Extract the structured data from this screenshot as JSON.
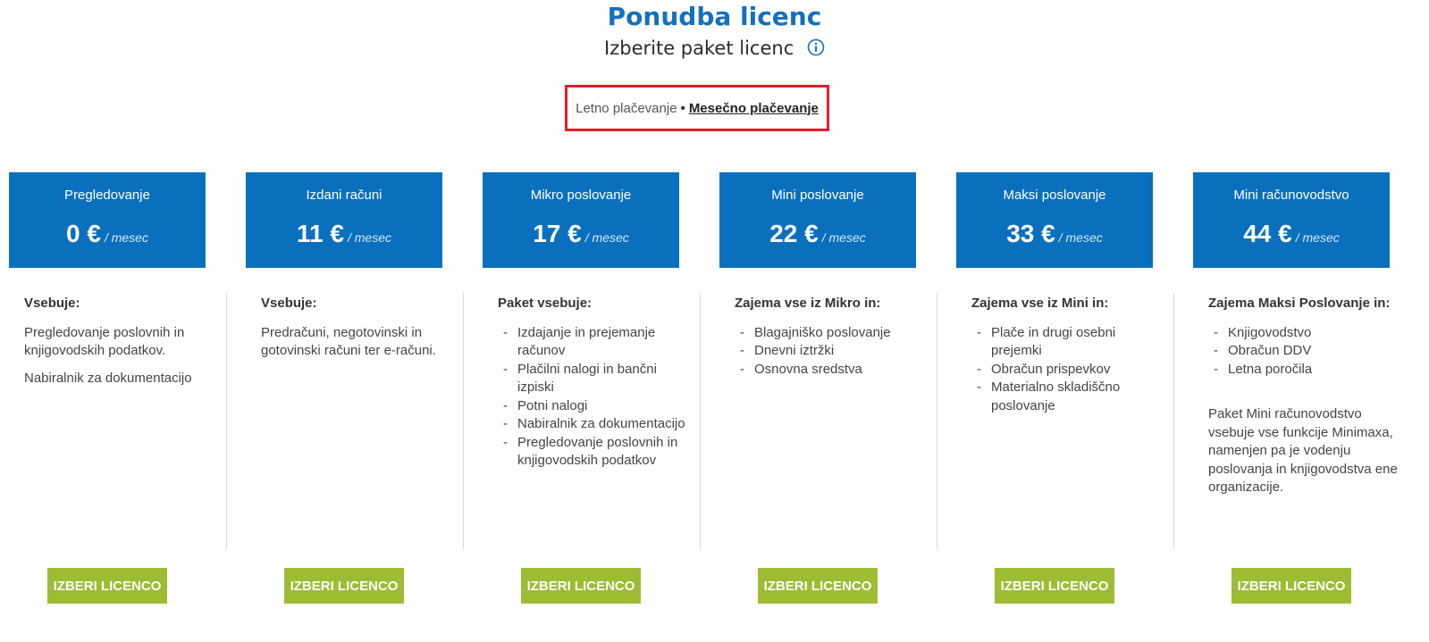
{
  "header": {
    "title": "Ponudba licenc",
    "subtitle": "Izberite paket licenc",
    "info_icon": "info-icon"
  },
  "billing_toggle": {
    "annual_label": "Letno plačevanje",
    "separator": "•",
    "monthly_label": "Mesečno plačevanje",
    "active": "monthly",
    "highlight_color": "#e0202a"
  },
  "colors": {
    "header_blue": "#0a70be",
    "title_blue": "#1470bb",
    "button_green": "#9ebb34"
  },
  "plans": [
    {
      "name": "Pregledovanje",
      "price": "0 €",
      "per": "/ mesec",
      "heading": "Vsebuje:",
      "paragraphs": [
        "Pregledovanje poslovnih in knjigovodskih podatkov.",
        "Nabiralnik za dokumentacijo"
      ],
      "items": [],
      "note": "",
      "button": "IZBERI LICENCO"
    },
    {
      "name": "Izdani računi",
      "price": "11 €",
      "per": "/ mesec",
      "heading": "Vsebuje:",
      "paragraphs": [
        "Predračuni, negotovinski in gotovinski računi ter e-računi."
      ],
      "items": [],
      "note": "",
      "button": "IZBERI LICENCO"
    },
    {
      "name": "Mikro poslovanje",
      "price": "17 €",
      "per": "/ mesec",
      "heading": "Paket vsebuje:",
      "paragraphs": [],
      "items": [
        "Izdajanje in prejemanje računov",
        "Plačilni nalogi in bančni izpiski",
        "Potni nalogi",
        "Nabiralnik za dokumentacijo",
        "Pregledovanje poslovnih in knjigovodskih podatkov"
      ],
      "note": "",
      "button": "IZBERI LICENCO"
    },
    {
      "name": "Mini poslovanje",
      "price": "22 €",
      "per": "/ mesec",
      "heading": "Zajema vse iz Mikro in:",
      "paragraphs": [],
      "items": [
        "Blagajniško poslovanje",
        "Dnevni iztržki",
        "Osnovna sredstva"
      ],
      "note": "",
      "button": "IZBERI LICENCO"
    },
    {
      "name": "Maksi poslovanje",
      "price": "33 €",
      "per": "/ mesec",
      "heading": "Zajema vse iz Mini in:",
      "paragraphs": [],
      "items": [
        "Plače in drugi osebni prejemki",
        "Obračun prispevkov",
        "Materialno skladiščno poslovanje"
      ],
      "note": "",
      "button": "IZBERI LICENCO"
    },
    {
      "name": "Mini računovodstvo",
      "price": "44 €",
      "per": "/ mesec",
      "heading": "Zajema Maksi Poslovanje in:",
      "paragraphs": [],
      "items": [
        "Knjigovodstvo",
        "Obračun DDV",
        "Letna poročila"
      ],
      "note": "Paket Mini računovodstvo vsebuje vse funkcije Minimaxa, namenjen pa je vodenju poslovanja in knjigovodstva ene organizacije.",
      "button": "IZBERI LICENCO"
    }
  ]
}
